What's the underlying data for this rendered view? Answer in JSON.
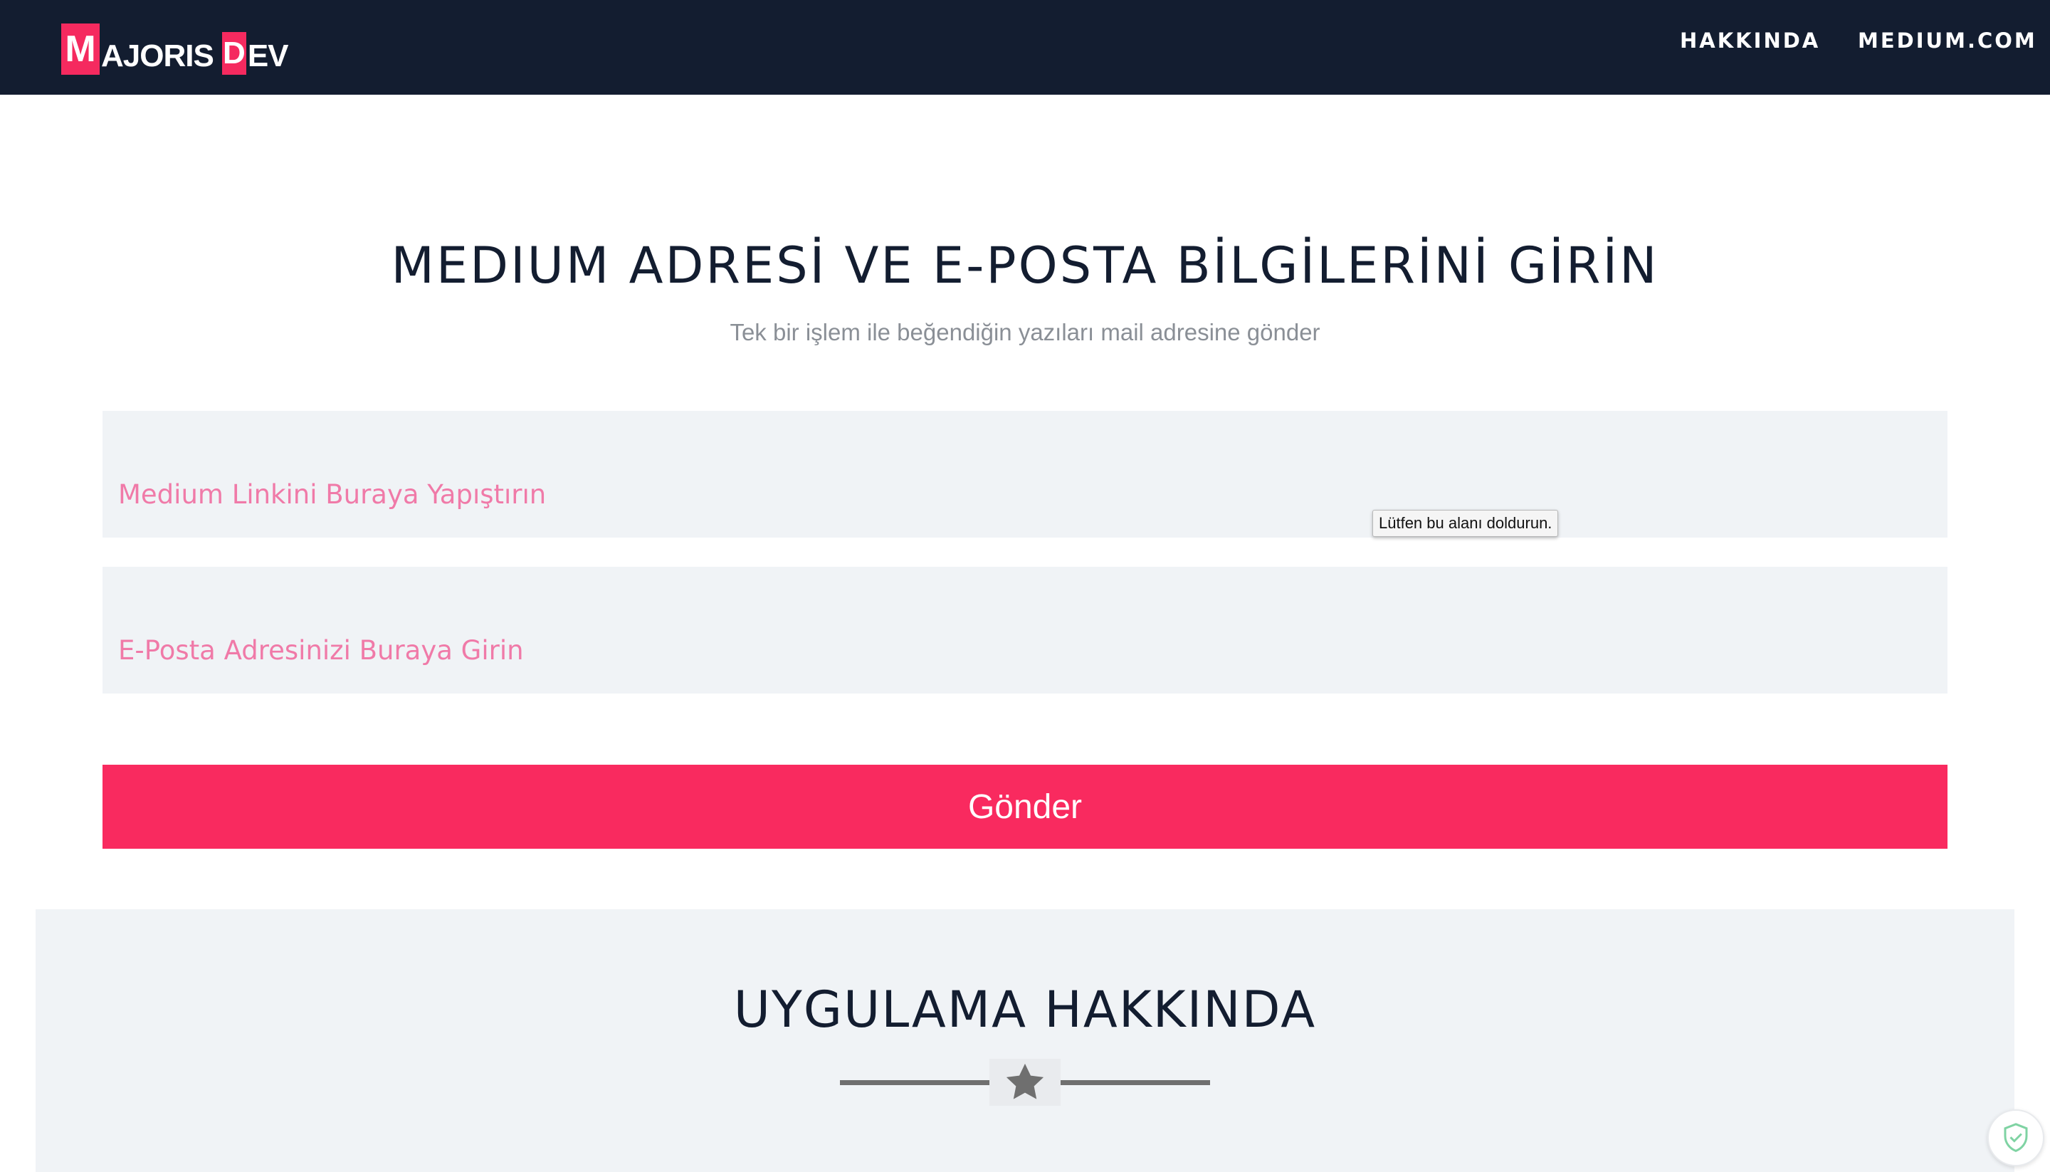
{
  "brand": {
    "logo_m": "M",
    "logo_name": "AJORIS",
    "logo_d": "D",
    "logo_rest": "EV"
  },
  "nav": {
    "about": "HAKKINDA",
    "medium": "MEDIUM.COM"
  },
  "hero": {
    "title": "MEDIUM ADRESİ VE E-POSTA BİLGİLERİNİ GİRİN",
    "subtitle": "Tek bir işlem ile beğendiğin yazıları mail adresine gönder"
  },
  "form": {
    "medium_link": {
      "placeholder": "Medium Linkini Buraya Yapıştırın",
      "value": ""
    },
    "email": {
      "placeholder": "E-Posta Adresinizi Buraya Girin",
      "value": ""
    },
    "validation_tooltip": "Lütfen bu alanı doldurun.",
    "submit_label": "Gönder"
  },
  "about": {
    "title": "UYGULAMA HAKKINDA"
  },
  "icons": {
    "divider": "star-icon",
    "badge": "shield-check-icon"
  },
  "colors": {
    "navbar_bg": "#131d30",
    "accent": "#f92a5f",
    "field_bg": "#f0f3f6",
    "placeholder": "#f07aa8"
  }
}
